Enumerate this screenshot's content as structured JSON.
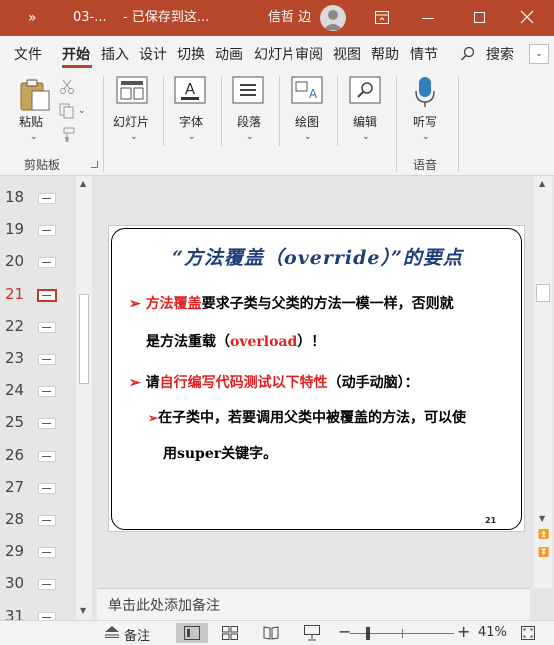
{
  "titlebar": {
    "qat_more": "»",
    "filename": "03-...",
    "saved_status": "- 已保存到这...",
    "user_name": "信哲 边",
    "accent": "#b7472a"
  },
  "ribbon_tabs": [
    "文件",
    "开始",
    "插入",
    "设计",
    "切换",
    "动画",
    "幻灯片",
    "审阅",
    "视图",
    "帮助",
    "情节",
    "搜索"
  ],
  "active_tab": "开始",
  "ribbon": {
    "paste_label": "粘贴",
    "clipboard_group": "剪贴板",
    "slides_label": "幻灯片",
    "font_label": "字体",
    "paragraph_label": "段落",
    "drawing_label": "绘图",
    "editing_label": "编辑",
    "dictate_label": "听写",
    "voice_group": "语音"
  },
  "thumbnails": [
    {
      "num": "18"
    },
    {
      "num": "19"
    },
    {
      "num": "20"
    },
    {
      "num": "21",
      "active": true
    },
    {
      "num": "22"
    },
    {
      "num": "23"
    },
    {
      "num": "24"
    },
    {
      "num": "25"
    },
    {
      "num": "26"
    },
    {
      "num": "27"
    },
    {
      "num": "28"
    },
    {
      "num": "29"
    },
    {
      "num": "30"
    },
    {
      "num": "31"
    }
  ],
  "slide": {
    "title": "“方法覆盖（override）”的要点",
    "b1_red": "方法覆盖",
    "b1_rest": "要求子类与父类的方法一模一样，否则就",
    "b1_line2_a": "是方法重载（",
    "b1_line2_red": "overload",
    "b1_line2_b": "）！",
    "b2_a": "请",
    "b2_red": "自行编写代码测试以下特性",
    "b2_b": "（动手动脑）：",
    "b3_line1": "在子类中，若要调用父类中被覆盖的方法，可以使",
    "b3_line2": "用super关键字。",
    "page_number": "21"
  },
  "notes": {
    "placeholder": "单击此处添加备注"
  },
  "status": {
    "notes_button": "备注",
    "zoom": "41%"
  }
}
